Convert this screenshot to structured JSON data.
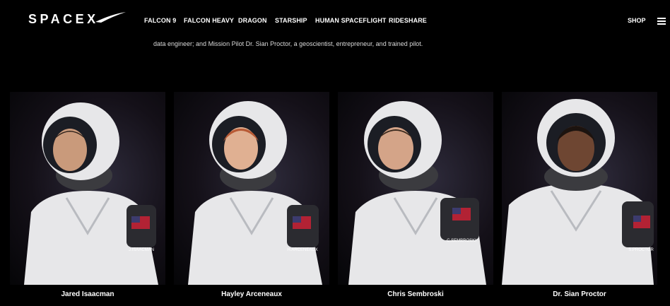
{
  "header": {
    "logo": "SPACEX",
    "nav": [
      {
        "label": "FALCON 9"
      },
      {
        "label": "FALCON HEAVY"
      },
      {
        "label": "DRAGON"
      },
      {
        "label": "STARSHIP"
      },
      {
        "label": "HUMAN SPACEFLIGHT"
      },
      {
        "label": "RIDESHARE"
      }
    ],
    "shop_label": "SHOP",
    "menu_icon": "hamburger-menu-icon"
  },
  "intro_text": "data engineer; and Mission Pilot Dr. Sian Proctor, a geoscientist, entrepreneur, and trained pilot.",
  "crew": [
    {
      "name": "Jared Isaacman",
      "patch": "J.ISAACMAN",
      "hair": "#2a1f18",
      "skin": "#c99a7b"
    },
    {
      "name": "Hayley Arceneaux",
      "patch": "H.ARCENEAUX",
      "hair": "#b85a35",
      "skin": "#e0b092"
    },
    {
      "name": "Chris Sembroski",
      "patch": "C.SEMBROSKI",
      "hair": "#3b2a1e",
      "skin": "#d4a488"
    },
    {
      "name": "Dr. Sian Proctor",
      "patch": "S.PROCTOR",
      "hair": "#1c130f",
      "skin": "#6e4632"
    }
  ],
  "colors": {
    "suit": "#e7e7e9",
    "suit_shadow": "#b9bbc0",
    "neck": "#3b3b3f",
    "background": "#000000"
  }
}
